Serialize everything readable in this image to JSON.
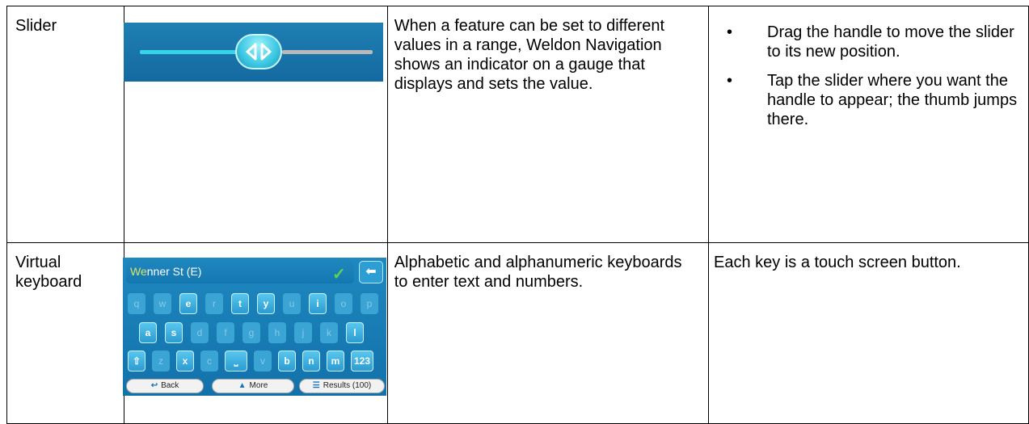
{
  "rows": [
    {
      "name": "Slider",
      "description": "When a feature can be set to different values in a range, Weldon Navigation shows an indicator on a gauge that displays and sets the value.",
      "actions": [
        "Drag the handle to move the slider to its new position.",
        "Tap the slider where you want the handle to appear; the thumb jumps there."
      ],
      "bullet_glyph": "•",
      "image": {
        "handle_icon": "left-right-arrows-icon",
        "handle_glyph": "◁▷",
        "fill_color": "#36d3e9",
        "track_color": "#b9b9b9",
        "background_color": "#1674aa"
      }
    },
    {
      "name": "Virtual keyboard",
      "description": "Alphabetic and alphanumeric keyboards to enter text and numbers.",
      "actions_text": "Each key is a touch screen button.",
      "image": {
        "typed_prefix": "We",
        "suggestion_rest": "nner St (E)",
        "check_icon": "check-icon",
        "check_glyph": "✓",
        "backspace_icon": "backspace-arrow-icon",
        "backspace_glyph": "⬅",
        "keys_row1": [
          "q",
          "w",
          "e",
          "r",
          "t",
          "y",
          "u",
          "i",
          "o",
          "p"
        ],
        "keys_row1_active": [
          false,
          false,
          true,
          false,
          true,
          true,
          false,
          true,
          false,
          false
        ],
        "keys_row2": [
          "a",
          "s",
          "d",
          "f",
          "g",
          "h",
          "j",
          "k",
          "l"
        ],
        "keys_row2_active": [
          true,
          true,
          false,
          false,
          false,
          false,
          false,
          false,
          true
        ],
        "keys_row3": [
          "⇧",
          "z",
          "x",
          "c",
          "⎵",
          "v",
          "b",
          "n",
          "m",
          "123"
        ],
        "keys_row3_active": [
          true,
          false,
          true,
          false,
          true,
          false,
          true,
          true,
          true,
          true
        ],
        "buttons": {
          "back": {
            "label": "Back",
            "icon": "back-arrow-icon",
            "glyph": "↩"
          },
          "more": {
            "label": "More",
            "icon": "up-chevron-icon",
            "glyph": "▲"
          },
          "results": {
            "label": "Results (100)",
            "icon": "list-icon",
            "glyph": "☰"
          }
        }
      }
    }
  ]
}
